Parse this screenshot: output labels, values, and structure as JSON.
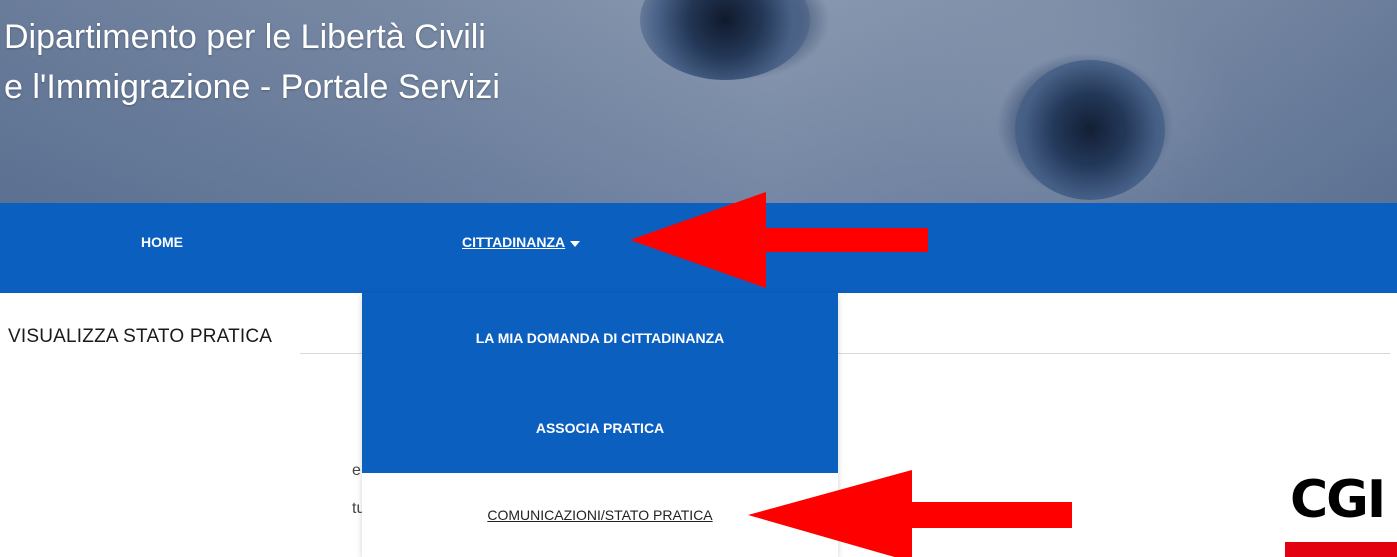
{
  "banner": {
    "title_line1": "Dipartimento per le Libertà Civili",
    "title_line2": "e l'Immigrazione - Portale Servizi"
  },
  "nav": {
    "home": "HOME",
    "cittadinanza": "CITTADINANZA"
  },
  "dropdown": {
    "items": [
      {
        "label": "LA MIA DOMANDA DI CITTADINANZA"
      },
      {
        "label": "ASSOCIA PRATICA"
      },
      {
        "label": "COMUNICAZIONI/STATO PRATICA"
      }
    ]
  },
  "section": {
    "title": "VISUALIZZA STATO PRATICA"
  },
  "fragments": {
    "line1": "e",
    "line2": "tu"
  },
  "logo": {
    "text": "CGI"
  },
  "colors": {
    "nav_blue": "#0b5fbf",
    "arrow_red": "#ff0000",
    "logo_red": "#e3000f"
  }
}
